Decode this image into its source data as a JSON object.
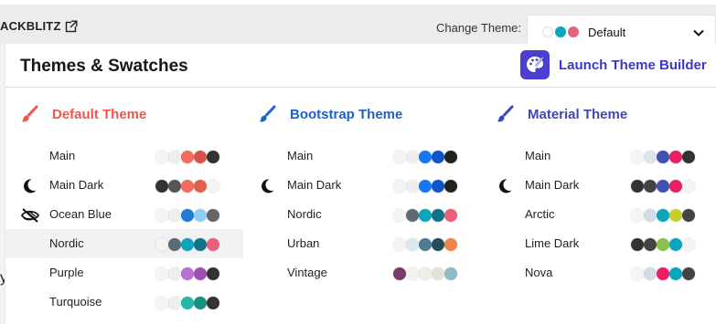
{
  "topbar": {
    "link_label": "ACKBLITZ",
    "change_theme_label": "Change Theme:",
    "selected_theme": "Default",
    "selected_swatches": [
      "#ffffff",
      "#0aa6bd",
      "#e8607a"
    ]
  },
  "background": {
    "stray_text": "y"
  },
  "panel": {
    "title": "Themes & Swatches",
    "launch_label": "Launch Theme Builder"
  },
  "columns": [
    {
      "title": "Default Theme",
      "color": "#f0564a",
      "themes": [
        {
          "name": "Main",
          "icon": "",
          "swatches": [
            "#f4f4f4",
            "#eeeeee",
            "#f26b5b",
            "#d9534a",
            "#333333"
          ]
        },
        {
          "name": "Main Dark",
          "icon": "moon-icon",
          "swatches": [
            "#333333",
            "#555555",
            "#f26b5b",
            "#e06050",
            "#f4f4f4"
          ]
        },
        {
          "name": "Ocean Blue",
          "icon": "eye-off-icon",
          "swatches": [
            "#f4f4f4",
            "#eeeeee",
            "#1f7bd4",
            "#8fd0f0",
            "#666666"
          ]
        },
        {
          "name": "Nordic",
          "icon": "",
          "selected": true,
          "swatches": [
            "#f4f4f4",
            "#5a6b75",
            "#0aa6bd",
            "#0e7288",
            "#e8607a"
          ]
        },
        {
          "name": "Purple",
          "icon": "",
          "swatches": [
            "#f4f4f4",
            "#eeeeee",
            "#b670d6",
            "#9b4fb0",
            "#333333"
          ]
        },
        {
          "name": "Turquoise",
          "icon": "",
          "swatches": [
            "#f4f4f4",
            "#eeeeee",
            "#25b8a8",
            "#16917f",
            "#333333"
          ]
        }
      ]
    },
    {
      "title": "Bootstrap Theme",
      "color": "#1b63c6",
      "themes": [
        {
          "name": "Main",
          "icon": "",
          "swatches": [
            "#f4f4f4",
            "#eeeeee",
            "#1677f2",
            "#0b57c9",
            "#222222"
          ]
        },
        {
          "name": "Main Dark",
          "icon": "moon-icon",
          "swatches": [
            "#f4f4f4",
            "#eeeeee",
            "#1677f2",
            "#0b57c9",
            "#222222"
          ]
        },
        {
          "name": "Nordic",
          "icon": "",
          "swatches": [
            "#f4f4f4",
            "#5a6b75",
            "#0aa6bd",
            "#0e7288",
            "#e8607a"
          ]
        },
        {
          "name": "Urban",
          "icon": "",
          "swatches": [
            "#f4f4f4",
            "#dde8ee",
            "#4d7b94",
            "#254a5c",
            "#f0824a"
          ]
        },
        {
          "name": "Vintage",
          "icon": "",
          "swatches": [
            "#7a3a6a",
            "#f2f2ee",
            "#eeeee8",
            "#e4e2d6",
            "#8fbac8"
          ]
        }
      ]
    },
    {
      "title": "Material Theme",
      "color": "#3f46b6",
      "themes": [
        {
          "name": "Main",
          "icon": "",
          "swatches": [
            "#f4f4f4",
            "#dfe3ea",
            "#3f51b5",
            "#e91e63",
            "#333333"
          ]
        },
        {
          "name": "Main Dark",
          "icon": "moon-icon",
          "swatches": [
            "#333333",
            "#444444",
            "#3f51b5",
            "#e91e63",
            "#f4f4f4"
          ]
        },
        {
          "name": "Arctic",
          "icon": "",
          "swatches": [
            "#f4f4f4",
            "#d2dde6",
            "#0aa6bd",
            "#c6d02a",
            "#444444"
          ]
        },
        {
          "name": "Lime Dark",
          "icon": "",
          "swatches": [
            "#333333",
            "#444444",
            "#8bc34a",
            "#0aa6bd",
            "#f4f4f4"
          ]
        },
        {
          "name": "Nova",
          "icon": "",
          "swatches": [
            "#f4f4f4",
            "#d2dde6",
            "#e91e63",
            "#0aa6bd",
            "#444444"
          ]
        }
      ]
    }
  ]
}
